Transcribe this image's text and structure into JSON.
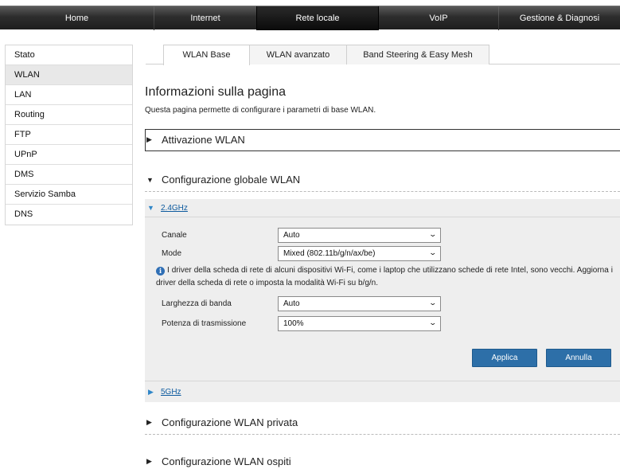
{
  "topnav": {
    "items": [
      {
        "label": "Home"
      },
      {
        "label": "Internet"
      },
      {
        "label": "Rete locale"
      },
      {
        "label": "VoIP"
      },
      {
        "label": "Gestione & Diagnosi"
      }
    ],
    "active": "Rete locale"
  },
  "sidebar": {
    "items": [
      {
        "label": "Stato"
      },
      {
        "label": "WLAN"
      },
      {
        "label": "LAN"
      },
      {
        "label": "Routing"
      },
      {
        "label": "FTP"
      },
      {
        "label": "UPnP"
      },
      {
        "label": "DMS"
      },
      {
        "label": "Servizio Samba"
      },
      {
        "label": "DNS"
      }
    ],
    "active": "WLAN"
  },
  "tabs": [
    {
      "label": "WLAN Base"
    },
    {
      "label": "WLAN avanzato"
    },
    {
      "label": "Band Steering & Easy Mesh"
    }
  ],
  "page": {
    "title": "Informazioni sulla pagina",
    "description": "Questa pagina permette di configurare i parametri di base WLAN."
  },
  "sections": {
    "attivazione": "Attivazione WLAN",
    "globale": "Configurazione globale WLAN",
    "privata": "Configurazione WLAN privata",
    "ospiti": "Configurazione WLAN ospiti"
  },
  "band24": {
    "label": "2.4GHz",
    "fields": {
      "canale": {
        "label": "Canale",
        "value": "Auto"
      },
      "mode": {
        "label": "Mode",
        "value": "Mixed (802.11b/g/n/ax/be)"
      },
      "larghezza": {
        "label": "Larghezza di banda",
        "value": "Auto"
      },
      "potenza": {
        "label": "Potenza di trasmissione",
        "value": "100%"
      }
    },
    "info": "I driver della scheda di rete di alcuni dispositivi Wi-Fi, come i laptop che utilizzano schede di rete Intel, sono vecchi. Aggiorna i driver della scheda di rete o imposta la modalità Wi-Fi su b/g/n."
  },
  "band5": {
    "label": "5GHz"
  },
  "buttons": {
    "apply": "Applica",
    "cancel": "Annulla"
  },
  "colors": {
    "accent": "#2d6fa8",
    "nav_dark": "#1e1e1e",
    "link": "#0c5a9e"
  }
}
